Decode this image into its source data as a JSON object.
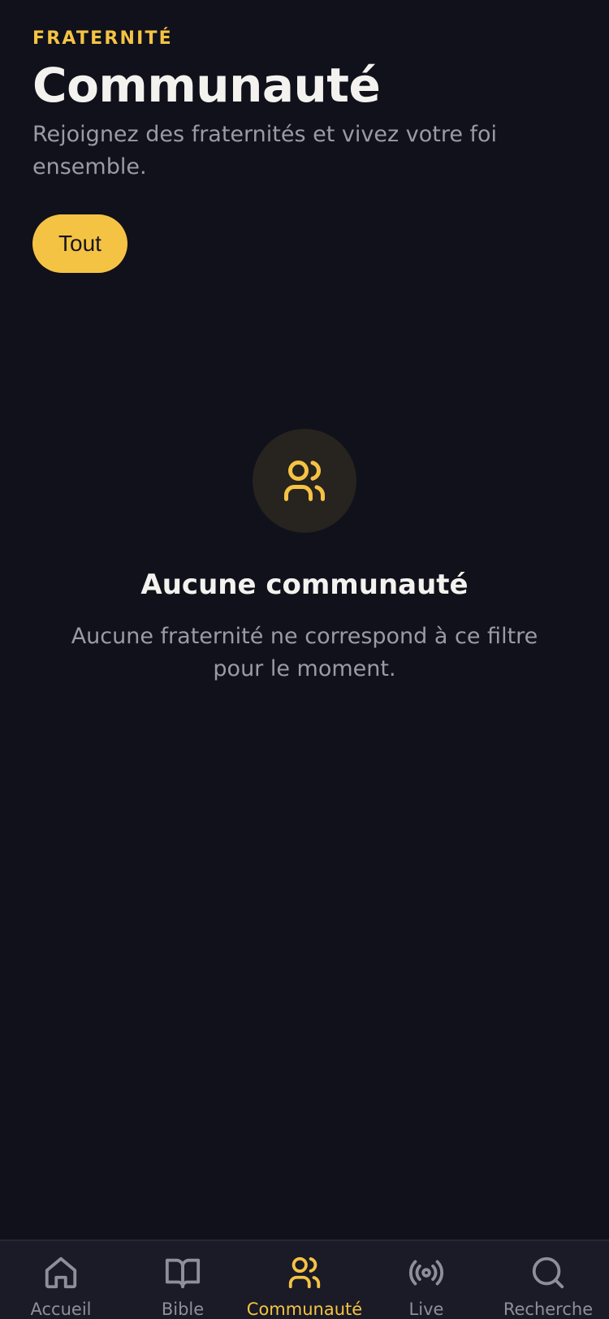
{
  "header": {
    "eyebrow": "FRATERNITÉ",
    "title": "Communauté",
    "subtitle": "Rejoignez des fraternités et vivez votre foi ensemble."
  },
  "filters": {
    "active": "Tout"
  },
  "empty_state": {
    "icon": "users-icon",
    "title": "Aucune communauté",
    "message": "Aucune fraternité ne correspond à ce filtre pour le moment."
  },
  "tabbar": {
    "items": [
      {
        "label": "Accueil",
        "icon": "home-icon",
        "active": false
      },
      {
        "label": "Bible",
        "icon": "book-icon",
        "active": false
      },
      {
        "label": "Communauté",
        "icon": "users-icon",
        "active": true
      },
      {
        "label": "Live",
        "icon": "broadcast-icon",
        "active": false
      },
      {
        "label": "Recherche",
        "icon": "search-icon",
        "active": false
      }
    ]
  },
  "colors": {
    "background": "#10111b",
    "accent": "#f5c344",
    "text_primary": "#f3f2ee",
    "text_secondary": "#9a9ba3",
    "tabbar_background": "#1a1b26"
  }
}
